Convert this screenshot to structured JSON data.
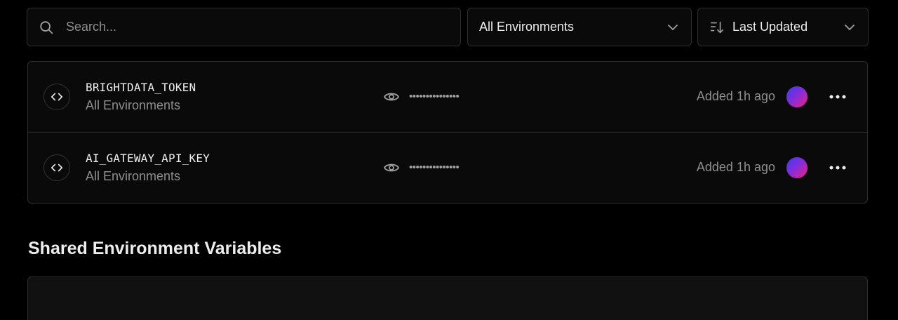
{
  "search": {
    "placeholder": "Search..."
  },
  "filters": {
    "environment": {
      "selected": "All Environments"
    },
    "sort": {
      "selected": "Last Updated"
    }
  },
  "variables": [
    {
      "name": "BRIGHTDATA_TOKEN",
      "environment": "All Environments",
      "masked_value": "•••••••••••••••",
      "updated": "Added 1h ago"
    },
    {
      "name": "AI_GATEWAY_API_KEY",
      "environment": "All Environments",
      "masked_value": "•••••••••••••••",
      "updated": "Added 1h ago"
    }
  ],
  "shared_section": {
    "title": "Shared Environment Variables"
  },
  "colors": {
    "background": "#000000",
    "panel": "#0a0a0a",
    "border": "#2e2e2e",
    "text_primary": "#ededed",
    "text_secondary": "#8f8f8f",
    "avatar_gradient": [
      "#3b3bf2",
      "#8b2bd6",
      "#f0217a"
    ]
  },
  "icons": {
    "search": "search-icon",
    "sort": "sort-descending-icon",
    "chevron": "chevron-down-icon",
    "code": "code-brackets-icon",
    "reveal": "eye-icon",
    "more": "more-horizontal-icon"
  }
}
